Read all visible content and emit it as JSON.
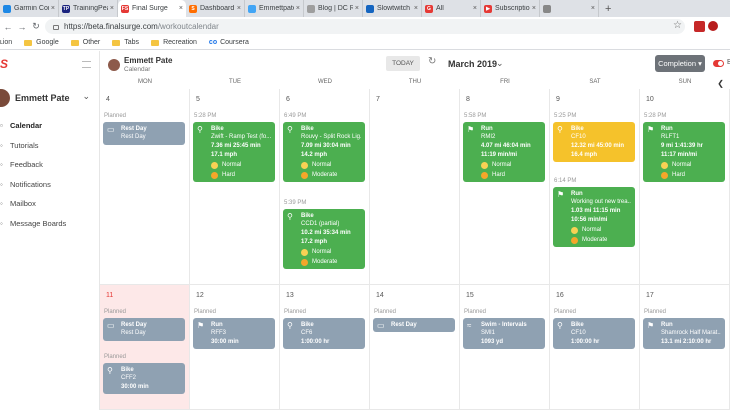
{
  "tabs": [
    {
      "label": "Garmin Conne",
      "color": "#1e88e5",
      "glyph": ""
    },
    {
      "label": "TrainingPeaks",
      "color": "#1a237e",
      "glyph": "TP"
    },
    {
      "label": "Final Surge",
      "color": "#e53935",
      "glyph": "FS",
      "active": true
    },
    {
      "label": "Dashboard | St",
      "color": "#ff6d00",
      "glyph": "S"
    },
    {
      "label": "Emmettpate's",
      "color": "#42a5f5",
      "glyph": ""
    },
    {
      "label": "Blog | DC Rain",
      "color": "#9e9e9e",
      "glyph": ""
    },
    {
      "label": "Slowtwitch For",
      "color": "#1565c0",
      "glyph": ""
    },
    {
      "label": "All",
      "color": "#e53935",
      "glyph": "G"
    },
    {
      "label": "Subscriptions",
      "color": "#e53935",
      "glyph": "▶"
    },
    {
      "label": "",
      "color": "#888",
      "glyph": ""
    }
  ],
  "new_tab": "+",
  "tab_close": "×",
  "address": {
    "host": "https://beta.finalsurge.com",
    "path": "/workoutcalendar"
  },
  "bookmarks": {
    "apps": "ʟion",
    "items": [
      "Google",
      "Other",
      "Tabs",
      "Recreation"
    ],
    "coursera": "Coursera"
  },
  "sidebar": {
    "logo": "S",
    "user_name": "Emmett Pate",
    "items": [
      {
        "label": "Calendar",
        "icon": "calendar-icon"
      },
      {
        "label": "Tutorials",
        "icon": "tutorials-icon"
      },
      {
        "label": "Feedback",
        "icon": "feedback-icon"
      },
      {
        "label": "Notifications",
        "icon": "bell-icon"
      },
      {
        "label": "Mailbox",
        "icon": "mail-icon"
      },
      {
        "label": "Message Boards",
        "icon": "messages-icon"
      }
    ]
  },
  "header": {
    "name": "Emmett Pate",
    "sub": "Calendar",
    "today": "TODAY",
    "month": "March 2019",
    "completion": "Completion ▾",
    "toggle_text": "B"
  },
  "days": [
    "MON",
    "TUE",
    "WED",
    "THU",
    "FRI",
    "SAT",
    "SUN"
  ],
  "weeks": [
    [
      {
        "date": "4",
        "entries": [
          {
            "label": "Planned",
            "color": "gray",
            "icon": "rest",
            "title": "Rest Day",
            "sub": "Rest Day"
          }
        ]
      },
      {
        "date": "5",
        "entries": [
          {
            "label": "5:28 PM",
            "color": "green",
            "icon": "bike",
            "title": "Bike",
            "sub": "Zwift - Ramp Test (fo...",
            "stats": [
              "7.36 mi  25:45 min",
              "17.1 mph"
            ],
            "feel": "Normal",
            "effort": "Hard"
          }
        ]
      },
      {
        "date": "6",
        "entries": [
          {
            "label": "6:49 PM",
            "color": "green",
            "icon": "bike",
            "title": "Bike",
            "sub": "Rouvy - Split Rock Lig...",
            "stats": [
              "7.09 mi  30:04 min",
              "14.2 mph"
            ],
            "feel": "Normal",
            "effort": "Moderate"
          },
          {
            "label": "5:39 PM",
            "color": "green",
            "icon": "bike",
            "title": "Bike",
            "sub": "CCD1 (partial)",
            "stats": [
              "10.2 mi  35:34 min",
              "17.2 mph"
            ],
            "feel": "Normal",
            "effort": "Moderate"
          }
        ]
      },
      {
        "date": "7",
        "entries": []
      },
      {
        "date": "8",
        "entries": [
          {
            "label": "5:58 PM",
            "color": "green",
            "icon": "run",
            "title": "Run",
            "sub": "RMI2",
            "stats": [
              "4.07 mi  46:04 min",
              "11:19 min/mi"
            ],
            "feel": "Normal",
            "effort": "Hard"
          }
        ]
      },
      {
        "date": "9",
        "entries": [
          {
            "label": "5:25 PM",
            "color": "yellow",
            "icon": "bike",
            "title": "Bike",
            "sub": "CF10",
            "stats": [
              "12.32 mi  45:00 min",
              "16.4 mph"
            ]
          },
          {
            "label": "6:14 PM",
            "color": "green",
            "icon": "run",
            "title": "Run",
            "sub": "Working out new trea...",
            "stats": [
              "1.03 mi  11:15 min",
              "10:56 min/mi"
            ],
            "feel": "Normal",
            "effort": "Moderate"
          }
        ]
      },
      {
        "date": "10",
        "entries": [
          {
            "label": "5:28 PM",
            "color": "green",
            "icon": "run",
            "title": "Run",
            "sub": "RLFT1",
            "stats": [
              "9 mi  1:41:39 hr",
              "11:17 min/mi"
            ],
            "feel": "Normal",
            "effort": "Hard"
          }
        ]
      }
    ],
    [
      {
        "date": "11",
        "highlight": true,
        "entries": [
          {
            "label": "Planned",
            "color": "gray",
            "icon": "rest",
            "title": "Rest Day",
            "sub": "Rest Day"
          },
          {
            "label": "Planned",
            "color": "gray",
            "icon": "bike",
            "title": "Bike",
            "sub": "CFF2",
            "stats": [
              "30:00 min"
            ]
          }
        ]
      },
      {
        "date": "12",
        "entries": [
          {
            "label": "Planned",
            "color": "gray",
            "icon": "run",
            "title": "Run",
            "sub": "RFF3",
            "stats": [
              "30:00 min"
            ]
          }
        ]
      },
      {
        "date": "13",
        "entries": [
          {
            "label": "Planned",
            "color": "gray",
            "icon": "bike",
            "title": "Bike",
            "sub": "CF6",
            "stats": [
              "1:00:00 hr"
            ]
          }
        ]
      },
      {
        "date": "14",
        "entries": [
          {
            "label": "Planned",
            "color": "gray",
            "icon": "rest",
            "title": "Rest Day",
            "sub": ""
          }
        ]
      },
      {
        "date": "15",
        "entries": [
          {
            "label": "Planned",
            "color": "gray",
            "icon": "swim",
            "title": "Swim - Intervals",
            "sub": "SMI1",
            "stats": [
              "1093 yd"
            ]
          }
        ]
      },
      {
        "date": "16",
        "entries": [
          {
            "label": "Planned",
            "color": "gray",
            "icon": "bike",
            "title": "Bike",
            "sub": "CF10",
            "stats": [
              "1:00:00 hr"
            ]
          }
        ]
      },
      {
        "date": "17",
        "entries": [
          {
            "label": "Planned",
            "color": "gray",
            "icon": "run",
            "title": "Run",
            "sub": "Shamrock Half Marat...",
            "stats": [
              "13.1 mi  2:10:00 hr"
            ]
          }
        ]
      }
    ]
  ]
}
